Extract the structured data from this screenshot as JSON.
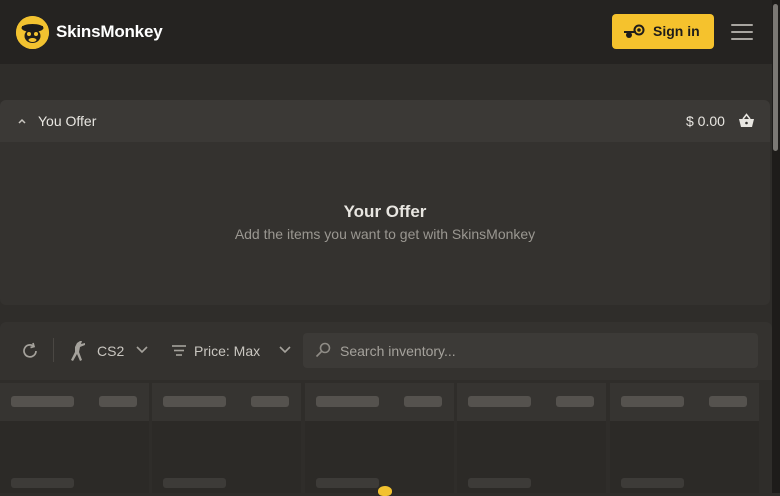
{
  "header": {
    "brand": "SkinsMonkey",
    "signin_label": "Sign in",
    "logo_icon": "monkey-logo-icon",
    "menu_icon": "hamburger-menu-icon"
  },
  "offer": {
    "title": "You Offer",
    "amount": "$ 0.00",
    "empty_title": "Your Offer",
    "empty_subtitle": "Add the items you want to get with SkinsMonkey"
  },
  "toolbar": {
    "game": "CS2",
    "price_filter": "Price: Max",
    "search_placeholder": "Search inventory..."
  },
  "colors": {
    "accent": "#f5c22d",
    "background": "#2f2d2a",
    "header": "#252321"
  }
}
